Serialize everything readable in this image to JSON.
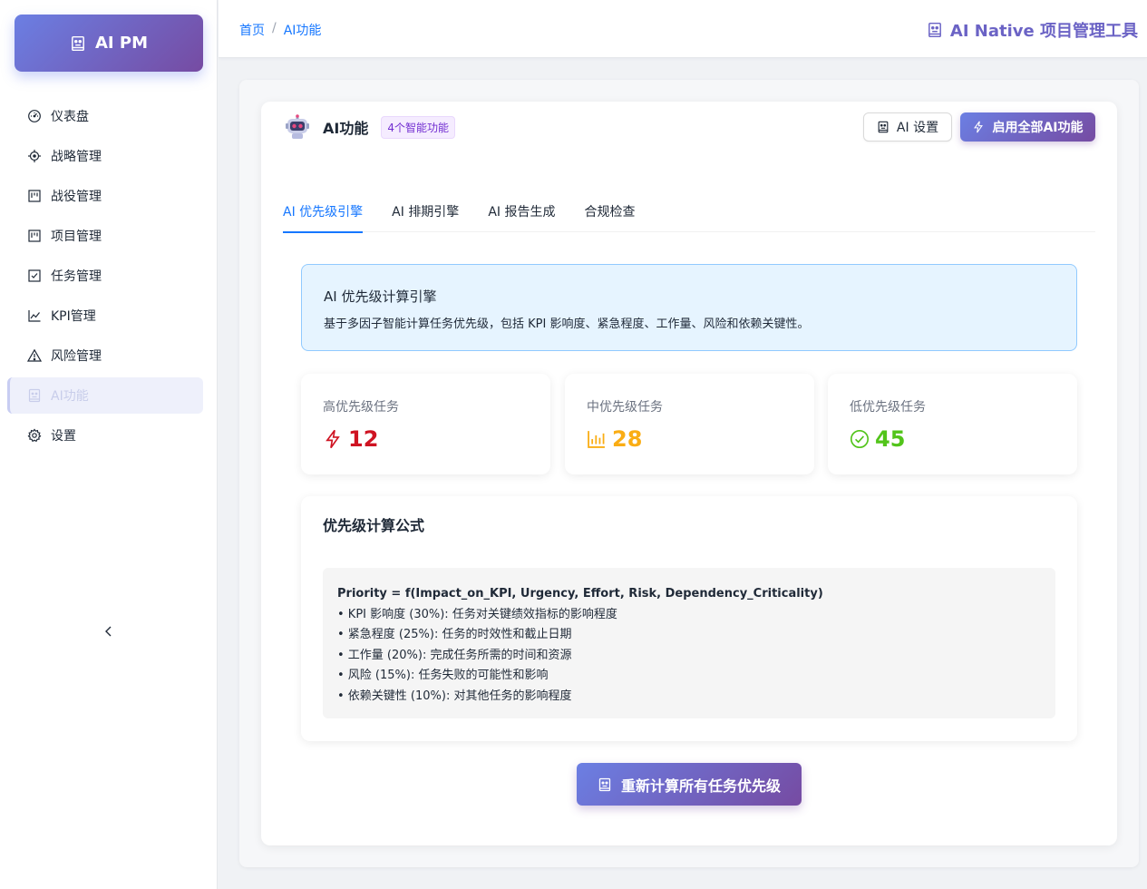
{
  "app": {
    "logo_text": "AI PM",
    "header_title": "AI Native 项目管理工具"
  },
  "breadcrumb": {
    "home": "首页",
    "separator": "/",
    "current": "AI功能"
  },
  "sidebar": {
    "items": [
      {
        "label": "仪表盘",
        "icon": "dashboard-icon"
      },
      {
        "label": "战略管理",
        "icon": "aim-icon"
      },
      {
        "label": "战役管理",
        "icon": "project-icon"
      },
      {
        "label": "项目管理",
        "icon": "project-icon"
      },
      {
        "label": "任务管理",
        "icon": "check-square-icon"
      },
      {
        "label": "KPI管理",
        "icon": "line-chart-icon"
      },
      {
        "label": "风险管理",
        "icon": "warning-icon"
      },
      {
        "label": "AI功能",
        "icon": "robot-icon",
        "active": true
      },
      {
        "label": "设置",
        "icon": "setting-icon"
      }
    ],
    "collapse_icon": "chevron-left-icon"
  },
  "card": {
    "title": "AI功能",
    "badge": "4个智能功能",
    "settings_button": "AI 设置",
    "enable_button": "启用全部AI功能"
  },
  "tabs": [
    {
      "label": "AI 优先级引擎",
      "active": true
    },
    {
      "label": "AI 排期引擎"
    },
    {
      "label": "AI 报告生成"
    },
    {
      "label": "合规检查"
    }
  ],
  "alert": {
    "title": "AI 优先级计算引擎",
    "description": "基于多因子智能计算任务优先级，包括 KPI 影响度、紧急程度、工作量、风险和依赖关键性。"
  },
  "stats": [
    {
      "label": "高优先级任务",
      "value": "12",
      "color": "#cf1322",
      "icon": "thunderbolt-icon"
    },
    {
      "label": "中优先级任务",
      "value": "28",
      "color": "#faad14",
      "icon": "bar-chart-icon"
    },
    {
      "label": "低优先级任务",
      "value": "45",
      "color": "#52c41a",
      "icon": "check-circle-icon"
    }
  ],
  "formula": {
    "title": "优先级计算公式",
    "main": "Priority = f(Impact_on_KPI, Urgency, Effort, Risk, Dependency_Criticality)",
    "lines": [
      "• KPI 影响度 (30%): 任务对关键绩效指标的影响程度",
      "• 紧急程度 (25%): 任务的时效性和截止日期",
      "• 工作量 (20%): 完成任务所需的时间和资源",
      "• 风险 (15%): 任务失败的可能性和影响",
      "• 依赖关键性 (10%): 对其他任务的影响程度"
    ]
  },
  "recalc_button": "重新计算所有任务优先级",
  "colors": {
    "primary": "#1677ff",
    "gradient_start": "#6b7fe3",
    "gradient_end": "#764ba2"
  }
}
